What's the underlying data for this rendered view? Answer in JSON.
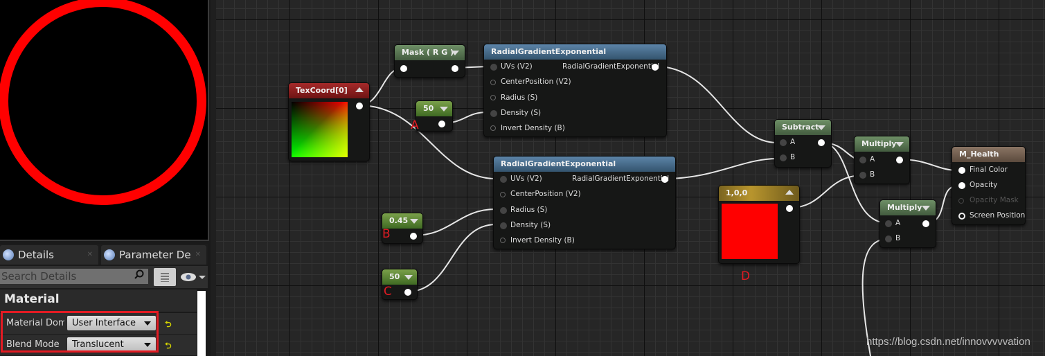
{
  "preview": {
    "shape": "ring",
    "ring_color": "#ff0000",
    "background": "#000000"
  },
  "details_panel": {
    "tabs": [
      {
        "label": "Details",
        "icon": "info-icon"
      },
      {
        "label": "Parameter De",
        "icon": "info-icon"
      }
    ],
    "search": {
      "placeholder": "Search Details",
      "value": ""
    },
    "section_title": "Material",
    "properties": [
      {
        "name": "Material Doma",
        "value": "User Interface"
      },
      {
        "name": "Blend Mode",
        "value": "Translucent"
      }
    ],
    "reset_glyph": "⮌",
    "highlight_color": "#e31b23"
  },
  "nodes": {
    "texcoord": {
      "title": "TexCoord[0]"
    },
    "mask": {
      "title": "Mask ( R G )"
    },
    "const50a": {
      "title": "50"
    },
    "rge1": {
      "title": "RadialGradientExponential",
      "output": "RadialGradientExponential",
      "inputs": [
        "UVs (V2)",
        "CenterPosition (V2)",
        "Radius (S)",
        "Density (S)",
        "Invert Density (B)"
      ]
    },
    "rge2": {
      "title": "RadialGradientExponential",
      "output": "RadialGradientExponential",
      "inputs": [
        "UVs (V2)",
        "CenterPosition (V2)",
        "Radius (S)",
        "Density (S)",
        "Invert Density (B)"
      ]
    },
    "const045": {
      "title": "0.45"
    },
    "const50b": {
      "title": "50"
    },
    "subtract": {
      "title": "Subtract",
      "inputs": [
        "A",
        "B"
      ]
    },
    "color": {
      "title": "1,0,0",
      "swatch": "#ff0000"
    },
    "multiply1": {
      "title": "Multiply",
      "inputs": [
        "A",
        "B"
      ]
    },
    "multiply2": {
      "title": "Multiply",
      "inputs": [
        "A",
        "B"
      ]
    },
    "result": {
      "title": "M_Health",
      "inputs": [
        "Final Color",
        "Opacity",
        "Opacity Mask",
        "Screen Position"
      ]
    }
  },
  "annotations": {
    "a": "A",
    "b": "B",
    "c": "C",
    "d": "D"
  },
  "watermark": "https://blog.csdn.net/innovvvvvation"
}
